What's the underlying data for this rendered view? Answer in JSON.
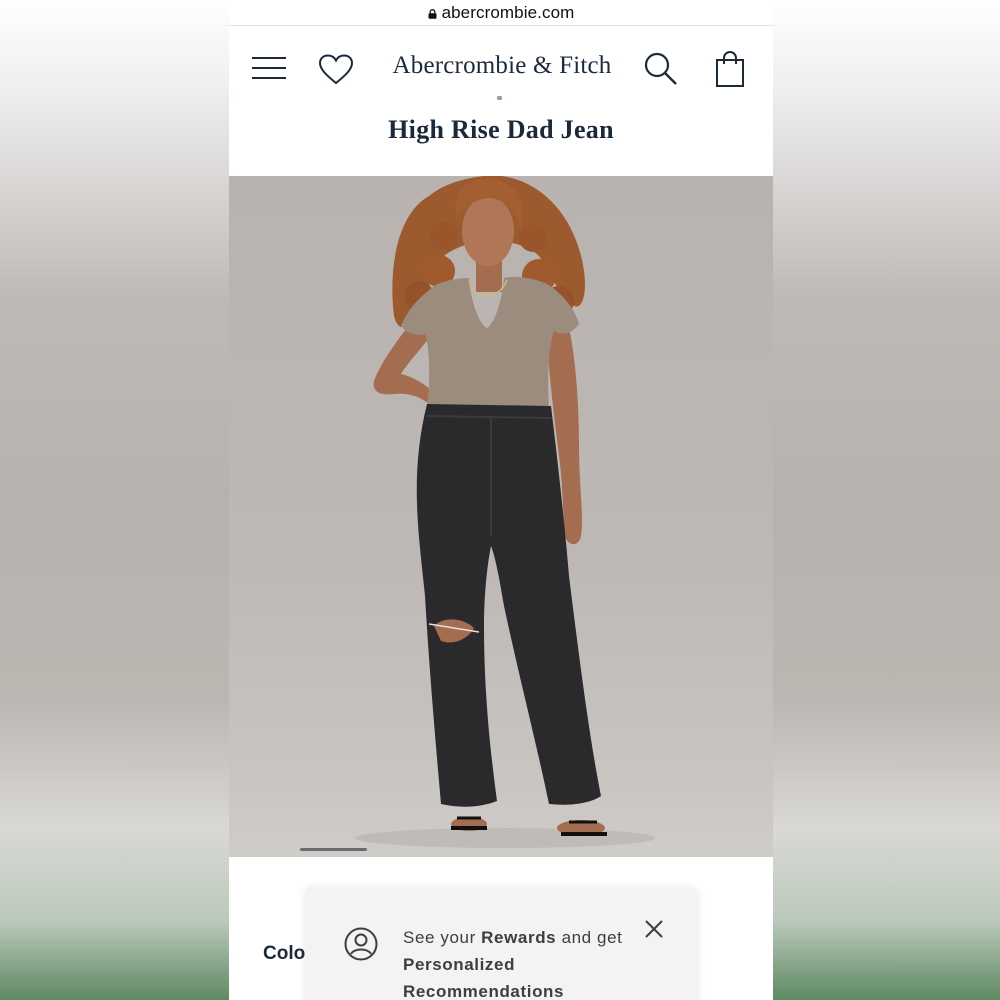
{
  "browser": {
    "url": "abercrombie.com",
    "lock_icon": "lock-icon"
  },
  "header": {
    "brand": "Abercrombie & Fitch",
    "icons": [
      "menu-icon",
      "heart-icon",
      "search-icon",
      "shopping-bag-icon"
    ]
  },
  "product": {
    "title": "High Rise Dad Jean"
  },
  "gallery": {
    "image": "model-wearing-black-high-rise-dad-jeans"
  },
  "details": {
    "color_label_partial": "Colo"
  },
  "rewards_popup": {
    "icon": "user-circle-icon",
    "text_pre": "See your ",
    "text_bold1": "Rewards",
    "text_mid": " and get ",
    "text_bold2": "Personalized Recommendations",
    "close_icon": "close-icon"
  },
  "colors": {
    "brand_navy": "#1b2a3b",
    "hero_bg": "#bbb6b2",
    "popup_bg": "#f4f3f1"
  }
}
